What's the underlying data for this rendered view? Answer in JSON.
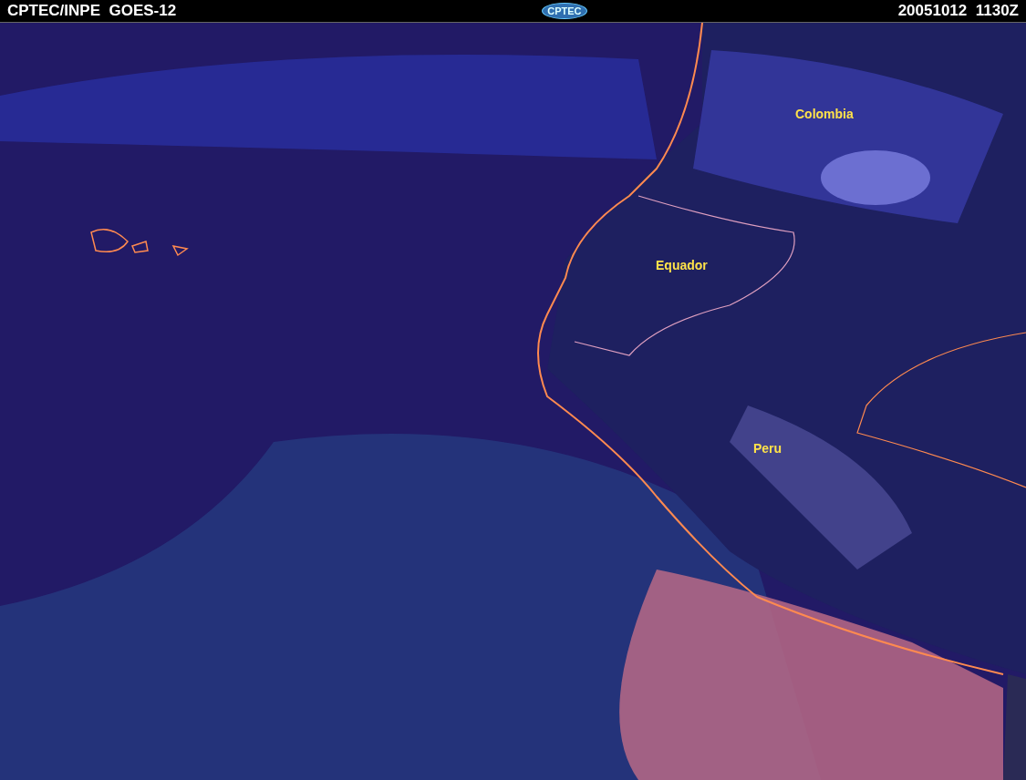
{
  "header": {
    "title": "CPTEC/INPE  GOES-12",
    "logo": "CPTEC",
    "timestamp": "20051012  1130Z"
  },
  "map": {
    "labels": [
      "Colombia",
      "Equador",
      "Peru"
    ]
  }
}
